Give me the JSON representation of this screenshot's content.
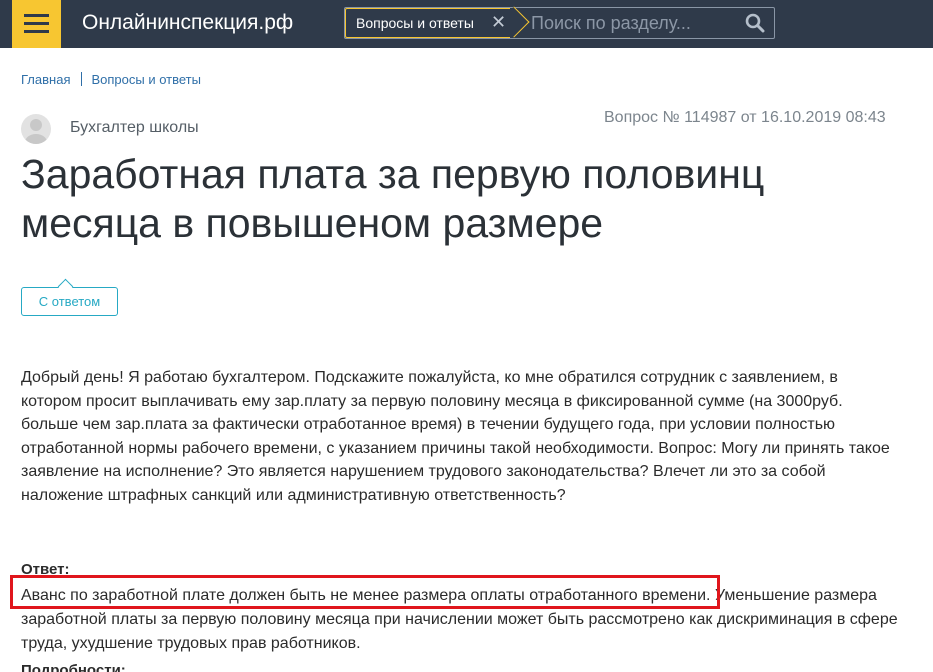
{
  "header": {
    "site_title": "Онлайнинспекция.рф",
    "search_tag": "Вопросы и ответы",
    "search_placeholder": "Поиск по разделу..."
  },
  "breadcrumb": {
    "items": [
      "Главная",
      "Вопросы и ответы"
    ]
  },
  "question": {
    "author": "Бухгалтер школы",
    "meta": "Вопрос № 114987 от 16.10.2019 08:43",
    "title": "Заработная плата за первую половинц месяца в повышеном размере",
    "status_badge": "С ответом",
    "body": "Добрый день! Я работаю бухгалтером. Подскажите пожалуйста, ко мне обратился сотрудник с заявлением, в котором просит выплачивать ему зар.плату за первую половину месяца в фиксированной сумме (на 3000руб. больше чем зар.плата за фактически отработанное время) в течении будущего года, при условии полностью отработанной нормы рабочего времени, с указанием причины такой необходимости. Вопрос: Могу ли принять такое заявление на исполнение? Это является нарушением трудового законодательства? Влечет ли это за собой наложение штрафных санкций или административную ответственность?"
  },
  "answer": {
    "label": "Ответ:",
    "body": "Аванс по заработной плате должен быть не менее размера оплаты отработанного времени. Уменьшение размера заработной платы за первую половину месяца при начислении может быть рассмотрено как дискриминация в сфере труда, ухудшение трудовых прав работников.",
    "next_label": "Подробности:"
  },
  "colors": {
    "topbar": "#2f3a4a",
    "accent_yellow": "#f7c631",
    "link_blue": "#2f6fa8",
    "badge_teal": "#26a9c4",
    "highlight_red": "#e0161c"
  },
  "icons": [
    "menu-icon",
    "close-icon",
    "search-icon",
    "user-avatar-icon"
  ]
}
